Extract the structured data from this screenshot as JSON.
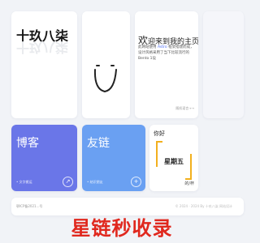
{
  "logo": {
    "text": "十玖八柒"
  },
  "intro": {
    "greeting": "欢",
    "title_rest": "迎来到我的主页",
    "emoji": "😊",
    "body_prefix": "此网站使用 ",
    "body_highlight": "Astro",
    "body_suffix": " 框架搭建而成，设计风格采用了当下比较流行的Bento 1设",
    "footer_link": "随机语言→→"
  },
  "tiles": {
    "blog": {
      "title": "博客",
      "subtitle": "• 文字搬运",
      "button": "↗"
    },
    "friends": {
      "title": "友链",
      "subtitle": "• 结识朋友",
      "button": "+"
    }
  },
  "weekday": {
    "greeting": "你好",
    "name": "星期五",
    "unit": "的/杯"
  },
  "footer": {
    "left": "鄂ICP备2021...号",
    "right": "© 2024 · 2024 By 十玖八柒 网站设计"
  },
  "watermark": "星链秒收录",
  "colors": {
    "blog": "#6a76e8",
    "friends": "#6aa0f2",
    "accent": "#f2b01e",
    "watermark": "#e0281e"
  }
}
